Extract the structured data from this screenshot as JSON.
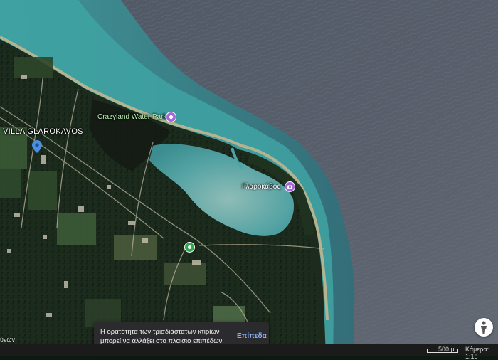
{
  "map": {
    "places": {
      "villa": "VILLA GLAROKAVOS",
      "water_park": "Crazyland Water Park",
      "beach": "Γλαροκάβος",
      "cut_left": "ύνων"
    },
    "icons": {
      "villa_pin": "location-pin-icon",
      "water_park_pin": "attraction-pin-icon",
      "beach_pin": "camera-pin-icon",
      "road_pin": "place-pin-icon",
      "pegman": "person-icon"
    },
    "colors": {
      "villa_pin": "#4a8fe0",
      "poi_pin": "#a468d6",
      "green_pin": "#33a852",
      "sea": "#525a68",
      "lagoon": "#4a9c9f",
      "land": "#1c2a1d"
    }
  },
  "toast": {
    "line1": "Η ορατότητα των τρισδιάστατων κτιρίων",
    "line2": "μπορεί να αλλάξει στο πλαίσιο επιπέδων.",
    "action": "Επίπεδα"
  },
  "status": {
    "scale": "500 μ.",
    "camera": "Κάμερα: 1:18"
  }
}
